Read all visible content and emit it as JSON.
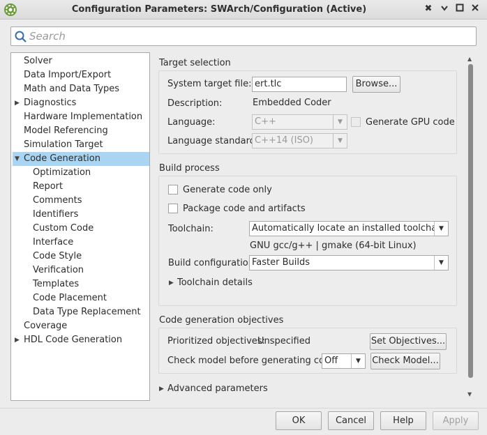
{
  "window": {
    "title": "Configuration Parameters: SWArch/Configuration (Active)",
    "controls": [
      "✖",
      "▲",
      "■",
      "✕"
    ]
  },
  "search": {
    "placeholder": "Search",
    "value": ""
  },
  "tree": {
    "items": [
      {
        "label": "Solver"
      },
      {
        "label": "Data Import/Export"
      },
      {
        "label": "Math and Data Types"
      },
      {
        "label": "Diagnostics",
        "expander": "▶"
      },
      {
        "label": "Hardware Implementation"
      },
      {
        "label": "Model Referencing"
      },
      {
        "label": "Simulation Target"
      },
      {
        "label": "Code Generation",
        "expander": "▼",
        "selected": true
      },
      {
        "label": "Optimization"
      },
      {
        "label": "Report"
      },
      {
        "label": "Comments"
      },
      {
        "label": "Identifiers"
      },
      {
        "label": "Custom Code"
      },
      {
        "label": "Interface"
      },
      {
        "label": "Code Style"
      },
      {
        "label": "Verification"
      },
      {
        "label": "Templates"
      },
      {
        "label": "Code Placement"
      },
      {
        "label": "Data Type Replacement"
      },
      {
        "label": "Coverage"
      },
      {
        "label": "HDL Code Generation",
        "expander": "▶"
      }
    ]
  },
  "target_selection": {
    "title": "Target selection",
    "system_target_label": "System target file:",
    "system_target_value": "ert.tlc",
    "browse_label": "Browse...",
    "description_label": "Description:",
    "description_value": "Embedded Coder",
    "language_label": "Language:",
    "language_value": "C++",
    "gpu_label": "Generate GPU code",
    "language_standard_label": "Language standard:",
    "language_standard_value": "C++14 (ISO)"
  },
  "build_process": {
    "title": "Build process",
    "generate_only_label": "Generate code only",
    "package_label": "Package code and artifacts",
    "toolchain_label": "Toolchain:",
    "toolchain_value": "Automatically locate an installed toolchain",
    "toolchain_info": "GNU gcc/g++ | gmake (64-bit Linux)",
    "build_config_label": "Build configuration:",
    "build_config_value": "Faster Builds",
    "toolchain_details_label": "Toolchain details"
  },
  "objectives": {
    "title": "Code generation objectives",
    "prioritized_label": "Prioritized objectives:",
    "prioritized_value": "Unspecified",
    "set_objectives_label": "Set Objectives...",
    "check_model_label": "Check model before generating code:",
    "check_model_value": "Off",
    "check_model_button": "Check Model..."
  },
  "advanced": {
    "label": "Advanced parameters"
  },
  "footer": {
    "ok": "OK",
    "cancel": "Cancel",
    "help": "Help",
    "apply": "Apply"
  }
}
